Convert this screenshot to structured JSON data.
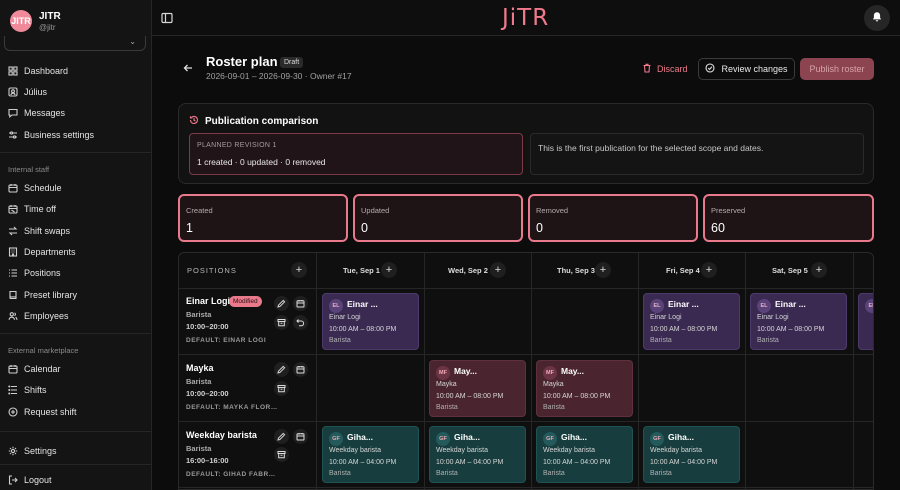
{
  "brand": {
    "initials": "JITR",
    "name": "JITR",
    "handle": "@jitr"
  },
  "nav": {
    "main": [
      {
        "label": "Dashboard",
        "icon": "dashboard-icon"
      },
      {
        "label": "Július",
        "icon": "user-icon"
      },
      {
        "label": "Messages",
        "icon": "messages-icon"
      },
      {
        "label": "Business settings",
        "icon": "sliders-icon"
      }
    ],
    "internal_label": "Internal staff",
    "internal": [
      {
        "label": "Schedule",
        "icon": "calendar-icon"
      },
      {
        "label": "Time off",
        "icon": "calendar-off-icon"
      },
      {
        "label": "Shift swaps",
        "icon": "swap-icon"
      },
      {
        "label": "Departments",
        "icon": "building-icon"
      },
      {
        "label": "Positions",
        "icon": "list-icon"
      },
      {
        "label": "Preset library",
        "icon": "book-icon"
      },
      {
        "label": "Employees",
        "icon": "users-icon"
      }
    ],
    "external_label": "External marketplace",
    "external": [
      {
        "label": "Calendar",
        "icon": "calendar-icon"
      },
      {
        "label": "Shifts",
        "icon": "shifts-icon"
      },
      {
        "label": "Request shift",
        "icon": "plus-circle-icon"
      }
    ],
    "settings": "Settings",
    "logout": "Logout"
  },
  "topbar": {
    "logo": "JiTR"
  },
  "header": {
    "title": "Roster plan",
    "badge": "Draft",
    "subtitle": "2026-09-01 – 2026-09-30 · Owner #17",
    "discard": "Discard",
    "review": "Review changes",
    "publish": "Publish roster"
  },
  "publication": {
    "title": "Publication comparison",
    "revision_label": "PLANNED REVISION 1",
    "revision_stats": "1 created · 0 updated · 0 removed",
    "info": "This is the first publication for the selected scope and dates."
  },
  "stats": [
    {
      "label": "Created",
      "value": "1"
    },
    {
      "label": "Updated",
      "value": "0"
    },
    {
      "label": "Removed",
      "value": "0"
    },
    {
      "label": "Preserved",
      "value": "60"
    }
  ],
  "grid": {
    "positions_label": "POSITIONS",
    "days": [
      "Tue, Sep 1",
      "Wed, Sep 2",
      "Thu, Sep 3",
      "Fri, Sep 4",
      "Sat, Sep 5"
    ],
    "rows": [
      {
        "name": "Einar Logi",
        "modified": "Modified",
        "role": "Barista",
        "time": "10:00–20:00",
        "default": "DEFAULT: EINAR LOGI"
      },
      {
        "name": "Mayka",
        "role": "Barista",
        "time": "10:00–20:00",
        "default": "DEFAULT: MAYKA FLOR…"
      },
      {
        "name": "Weekday barista",
        "role": "Barista",
        "time": "16:00–16:00",
        "default": "DEFAULT: GIHAD FABR…"
      }
    ],
    "shifts": {
      "einar": {
        "initials": "EL",
        "title": "Einar ...",
        "person": "Einar Logi",
        "time": "10:00 AM – 08:00 PM",
        "role": "Barista",
        "partial_initials": "EL"
      },
      "mayka": {
        "initials": "MF",
        "title": "May...",
        "person": "Mayka",
        "time": "10:00 AM – 08:00 PM",
        "role": "Barista"
      },
      "gihad": {
        "initials": "GF",
        "title": "Giha...",
        "person": "Weekday barista",
        "time": "10:00 AM – 04:00 PM",
        "role": "Barista"
      }
    }
  },
  "colors": {
    "accent": "#e87a8c",
    "shift_purple": "#3a2a52",
    "shift_rose": "#4a2530",
    "shift_teal": "#173d3e"
  }
}
